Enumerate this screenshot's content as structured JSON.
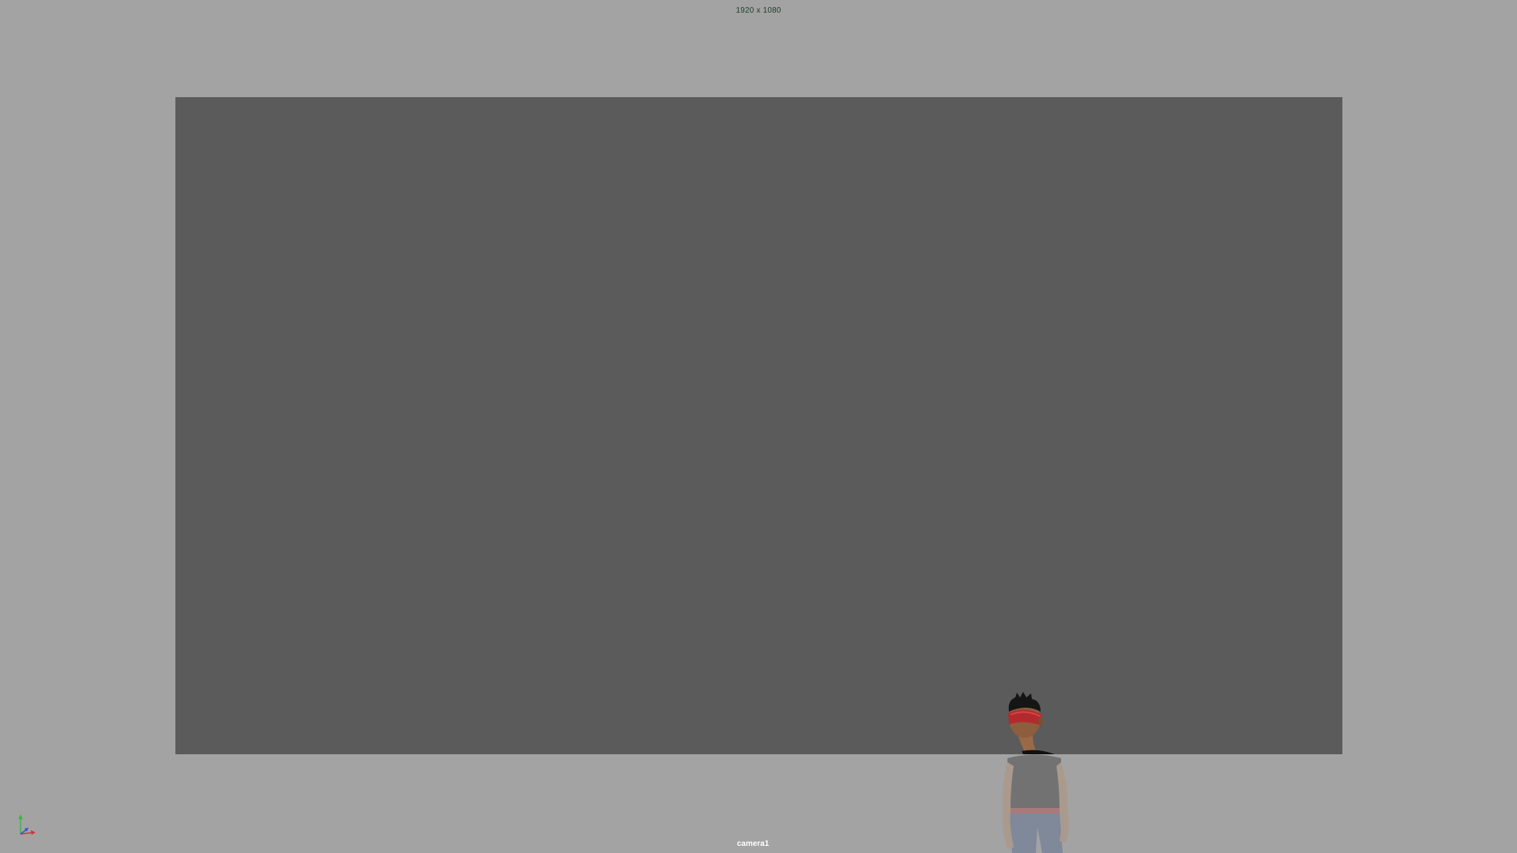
{
  "viewport": {
    "resolution_label": "1920 x 1080",
    "camera_name": "camera1",
    "colors": {
      "background": "#a3a3a3",
      "gate_fill": "#5b5b5b",
      "resolution_text": "#20402a",
      "camera_text": "#ffffff"
    },
    "axis_gizmo": {
      "icon": "axis-gizmo-icon",
      "axes": [
        "y-axis-green",
        "x-axis-red",
        "z-axis-blue"
      ]
    },
    "scene": {
      "object": "character-model"
    }
  }
}
